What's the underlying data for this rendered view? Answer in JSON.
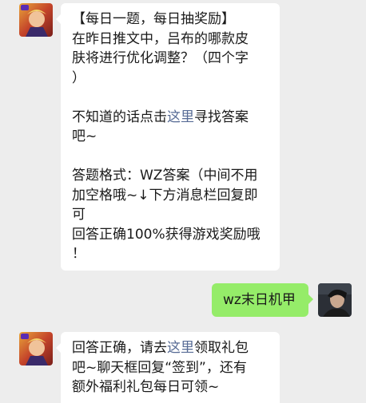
{
  "messages": [
    {
      "lines": [
        "【每日一题，每日抽奖励】",
        "在昨日推文中，吕布的哪款皮",
        "肤将进行优化调整？（四个字",
        "）"
      ],
      "hint": {
        "before": "不知道的话点击",
        "link": "这里",
        "after": "寻找答案",
        "tail": "吧~"
      },
      "format_lines": [
        "答题格式：WZ答案（中间不用",
        "加空格哦~↓下方消息栏回复即",
        "可",
        "回答正确100%获得游戏奖励哦",
        "！"
      ]
    },
    {
      "text": "wz末日机甲"
    },
    {
      "line1": {
        "before": "回答正确，请去",
        "link": "这里",
        "after": "领取礼包"
      },
      "line2": "吧~聊天框回复“签到”，还有",
      "line3": "额外福利礼包每日可领~"
    }
  ],
  "colors": {
    "background": "#ededed",
    "incoming_bubble": "#ffffff",
    "outgoing_bubble": "#95ec69",
    "link": "#576b95"
  }
}
